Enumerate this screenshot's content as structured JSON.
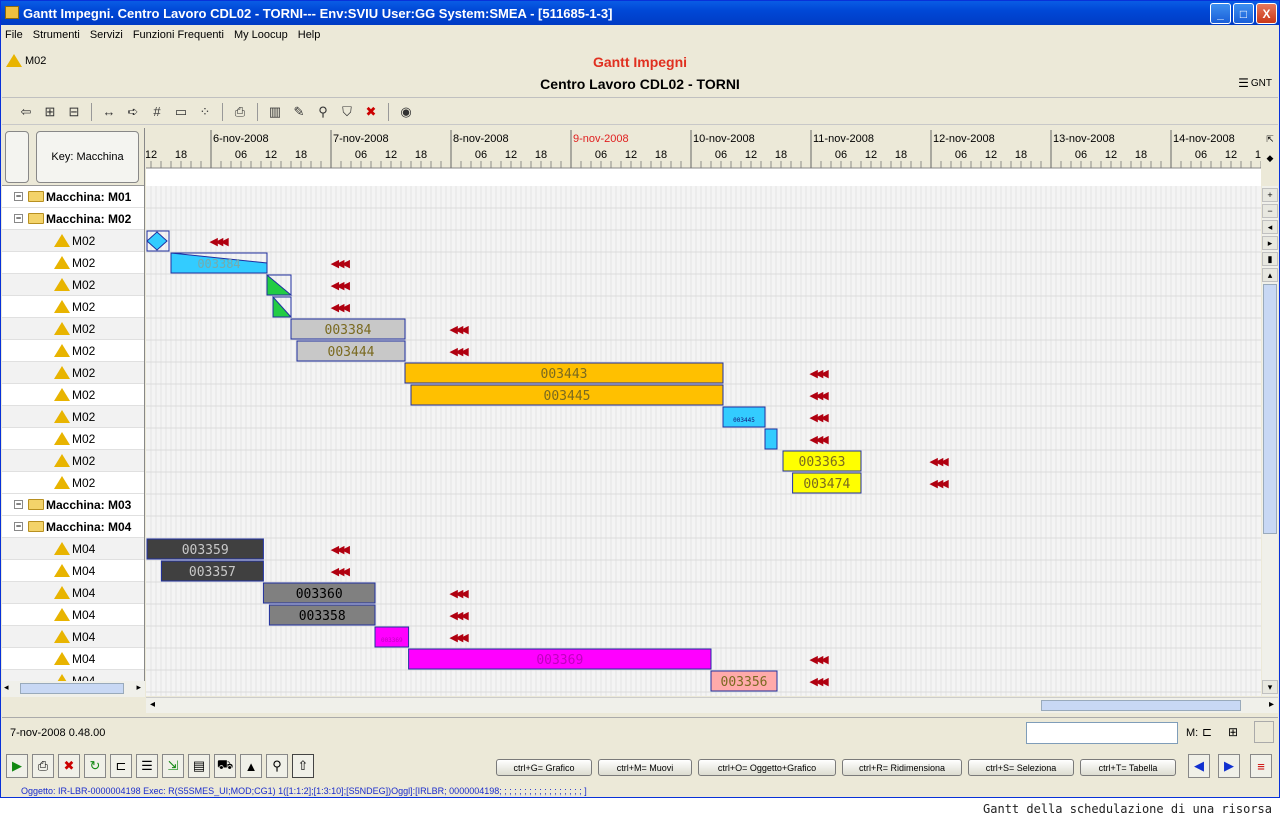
{
  "window": {
    "title": "Gantt Impegni. Centro Lavoro CDL02 - TORNI--- Env:SVIU User:GG System:SMEA - [511685-1-3]",
    "minimize": "_",
    "maximize": "□",
    "close": "X"
  },
  "menu": [
    "File",
    "Strumenti",
    "Servizi",
    "Funzioni Frequenti",
    "My Loocup",
    "Help"
  ],
  "header": {
    "resource": "M02",
    "title": "Gantt Impegni",
    "subtitle": "Centro Lavoro CDL02 - TORNI",
    "gnt": "GNT"
  },
  "left": {
    "key_button": "Key: Macchina",
    "rows": [
      {
        "type": "group",
        "label": "Macchina: M01"
      },
      {
        "type": "group",
        "label": "Macchina: M02"
      },
      {
        "type": "item",
        "label": "M02"
      },
      {
        "type": "item",
        "label": "M02"
      },
      {
        "type": "item",
        "label": "M02"
      },
      {
        "type": "item",
        "label": "M02"
      },
      {
        "type": "item",
        "label": "M02"
      },
      {
        "type": "item",
        "label": "M02"
      },
      {
        "type": "item",
        "label": "M02"
      },
      {
        "type": "item",
        "label": "M02"
      },
      {
        "type": "item",
        "label": "M02"
      },
      {
        "type": "item",
        "label": "M02"
      },
      {
        "type": "item",
        "label": "M02"
      },
      {
        "type": "item",
        "label": "M02"
      },
      {
        "type": "group",
        "label": "Macchina: M03"
      },
      {
        "type": "group",
        "label": "Macchina: M04"
      },
      {
        "type": "item",
        "label": "M04"
      },
      {
        "type": "item",
        "label": "M04"
      },
      {
        "type": "item",
        "label": "M04"
      },
      {
        "type": "item",
        "label": "M04"
      },
      {
        "type": "item",
        "label": "M04"
      },
      {
        "type": "item",
        "label": "M04"
      },
      {
        "type": "item",
        "label": "M04"
      }
    ]
  },
  "timeline": {
    "days": [
      {
        "label": "",
        "red": false
      },
      {
        "label": "6-nov-2008",
        "red": false
      },
      {
        "label": "7-nov-2008",
        "red": false
      },
      {
        "label": "8-nov-2008",
        "red": false
      },
      {
        "label": "9-nov-2008",
        "red": true
      },
      {
        "label": "10-nov-2008",
        "red": false
      },
      {
        "label": "11-nov-2008",
        "red": false
      },
      {
        "label": "12-nov-2008",
        "red": false
      },
      {
        "label": "13-nov-2008",
        "red": false
      },
      {
        "label": "14-nov-2008",
        "red": false
      }
    ],
    "hours": [
      "06",
      "12",
      "18"
    ]
  },
  "bars": [
    {
      "row": 2,
      "start": 0,
      "end": 0.2,
      "label": "",
      "color": "#33ccff",
      "shape": "diamond"
    },
    {
      "row": 3,
      "start": 0.2,
      "end": 1.0,
      "label": "003384",
      "color": "#33ccff",
      "shape": "wedge"
    },
    {
      "row": 4,
      "start": 1.0,
      "end": 1.2,
      "label": "",
      "color": "#22cc44",
      "shape": "tri"
    },
    {
      "row": 5,
      "start": 1.05,
      "end": 1.2,
      "label": "",
      "color": "#22cc44",
      "shape": "tri"
    },
    {
      "row": 6,
      "start": 1.2,
      "end": 2.15,
      "label": "003384",
      "color": "#c8c8c8",
      "shape": "rect"
    },
    {
      "row": 7,
      "start": 1.25,
      "end": 2.15,
      "label": "003444",
      "color": "#c8c8c8",
      "shape": "rect"
    },
    {
      "row": 8,
      "start": 2.15,
      "end": 4.8,
      "label": "003443",
      "color": "#ffc000",
      "shape": "rect"
    },
    {
      "row": 9,
      "start": 2.2,
      "end": 4.8,
      "label": "003445",
      "color": "#ffc000",
      "shape": "rect"
    },
    {
      "row": 10,
      "start": 4.8,
      "end": 5.15,
      "label": "003445",
      "color": "#33ccff",
      "shape": "rect"
    },
    {
      "row": 11,
      "start": 5.15,
      "end": 5.25,
      "label": "",
      "color": "#33ccff",
      "shape": "rect"
    },
    {
      "row": 12,
      "start": 5.3,
      "end": 5.95,
      "label": "003363",
      "color": "#ffff00",
      "shape": "rect"
    },
    {
      "row": 13,
      "start": 5.38,
      "end": 5.95,
      "label": "003474",
      "color": "#ffff00",
      "shape": "rect"
    },
    {
      "row": 16,
      "start": 0,
      "end": 0.97,
      "label": "003359",
      "color": "#404040",
      "shape": "rect"
    },
    {
      "row": 17,
      "start": 0.12,
      "end": 0.97,
      "label": "003357",
      "color": "#404040",
      "shape": "rect"
    },
    {
      "row": 18,
      "start": 0.97,
      "end": 1.9,
      "label": "003360",
      "color": "#808080",
      "shape": "rect"
    },
    {
      "row": 19,
      "start": 1.02,
      "end": 1.9,
      "label": "003358",
      "color": "#808080",
      "shape": "rect"
    },
    {
      "row": 20,
      "start": 1.9,
      "end": 2.18,
      "label": "003369",
      "color": "#ff00ff",
      "shape": "rect"
    },
    {
      "row": 21,
      "start": 2.18,
      "end": 4.7,
      "label": "003369",
      "color": "#ff00ff",
      "shape": "rect"
    },
    {
      "row": 22,
      "start": 4.7,
      "end": 5.25,
      "label": "003356",
      "color": "#ffaaaa",
      "shape": "rect"
    }
  ],
  "arrows": [
    {
      "row": 2,
      "pos": 0.52
    },
    {
      "row": 3,
      "pos": 1.53
    },
    {
      "row": 4,
      "pos": 1.53
    },
    {
      "row": 5,
      "pos": 1.53
    },
    {
      "row": 6,
      "pos": 2.52
    },
    {
      "row": 7,
      "pos": 2.52
    },
    {
      "row": 8,
      "pos": 5.52
    },
    {
      "row": 9,
      "pos": 5.52
    },
    {
      "row": 10,
      "pos": 5.52
    },
    {
      "row": 11,
      "pos": 5.52
    },
    {
      "row": 12,
      "pos": 6.52
    },
    {
      "row": 13,
      "pos": 6.52
    },
    {
      "row": 16,
      "pos": 1.53
    },
    {
      "row": 17,
      "pos": 1.53
    },
    {
      "row": 18,
      "pos": 2.52
    },
    {
      "row": 19,
      "pos": 2.52
    },
    {
      "row": 20,
      "pos": 2.52
    },
    {
      "row": 21,
      "pos": 5.52
    },
    {
      "row": 22,
      "pos": 5.52
    }
  ],
  "status": {
    "datetime": "7-nov-2008 0.48.00",
    "m_label": "M:"
  },
  "shortcuts": [
    "ctrl+G= Grafico",
    "ctrl+M= Muovi",
    "ctrl+O= Oggetto+Grafico",
    "ctrl+R= Ridimensiona",
    "ctrl+S= Seleziona",
    "ctrl+T= Tabella"
  ],
  "object_line": "Oggetto: IR-LBR-0000004198 Exec: R(S5SMES_UI;MOD;CG1) 1([1:1:2];[1:3:10];[S5NDEG])Oggl]:[IRLBR; 0000004198; ; ; ; ; ; ; ; ; ; ; ; ; ; ; ; ; ]",
  "caption": "Gantt della schedulazione di una risorsa"
}
